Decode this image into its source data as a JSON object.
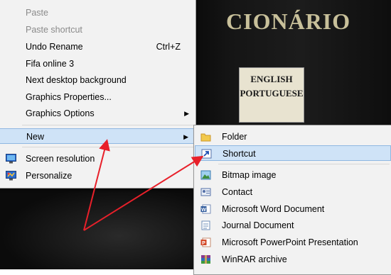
{
  "background": {
    "book_title": "CIONÁRIO",
    "book_label_lines": [
      "ENGLISH",
      "PORTUGUESE"
    ]
  },
  "context_menu": {
    "items": [
      {
        "label": "Paste"
      },
      {
        "label": "Paste shortcut"
      },
      {
        "label": "Undo Rename",
        "shortcut": "Ctrl+Z"
      },
      {
        "label": "Fifa online 3"
      },
      {
        "label": "Next desktop background"
      },
      {
        "label": "Graphics Properties..."
      },
      {
        "label": "Graphics Options"
      },
      {
        "label": "New"
      },
      {
        "label": "Screen resolution"
      },
      {
        "label": "Personalize"
      }
    ]
  },
  "new_submenu": {
    "items": [
      {
        "label": "Folder",
        "icon": "folder-icon"
      },
      {
        "label": "Shortcut",
        "icon": "shortcut-icon"
      },
      {
        "label": "Bitmap image",
        "icon": "bitmap-icon"
      },
      {
        "label": "Contact",
        "icon": "contact-icon"
      },
      {
        "label": "Microsoft Word Document",
        "icon": "word-icon"
      },
      {
        "label": "Journal Document",
        "icon": "journal-icon"
      },
      {
        "label": "Microsoft PowerPoint Presentation",
        "icon": "powerpoint-icon"
      },
      {
        "label": "WinRAR archive",
        "icon": "winrar-icon"
      }
    ]
  },
  "colors": {
    "highlight": "#cfe3f7",
    "annotation_arrow": "#e8202a"
  }
}
